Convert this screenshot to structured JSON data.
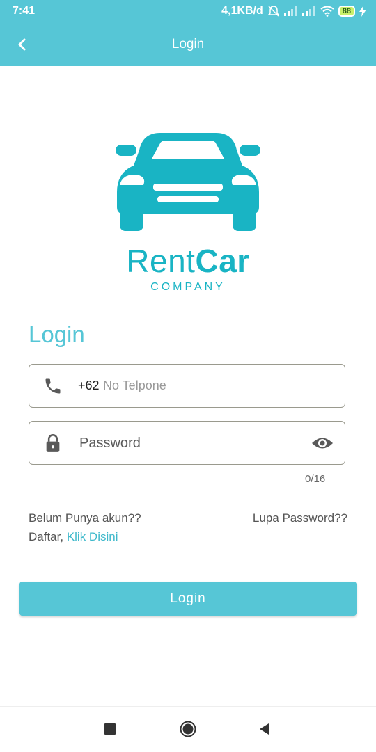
{
  "status_bar": {
    "time": "7:41",
    "network_speed": "4,1KB/d",
    "battery": "88",
    "icons": [
      "mute-bell-icon",
      "signal-icon",
      "signal-icon",
      "wifi-icon",
      "battery-icon",
      "charging-icon"
    ]
  },
  "app_bar": {
    "title": "Login",
    "back_icon": "chevron-left-icon"
  },
  "brand": {
    "name_light": "Rent",
    "name_bold": "Car",
    "tagline": "COMPANY"
  },
  "form": {
    "heading": "Login",
    "phone": {
      "icon": "phone-icon",
      "prefix": "+62",
      "placeholder": "No Telpone"
    },
    "password": {
      "icon": "lock-icon",
      "placeholder": "Password",
      "toggle_icon": "eye-icon",
      "counter": "0/16"
    },
    "register_question": "Belum Punya akun??",
    "register_prefix": "Daftar, ",
    "register_link": "Klik Disini",
    "forgot": "Lupa Password??",
    "submit": "Login"
  },
  "colors": {
    "primary": "#56c6d6",
    "brand": "#19b4c4"
  },
  "nav_bar": {
    "buttons": [
      "recents-icon",
      "home-icon",
      "back-icon"
    ]
  }
}
